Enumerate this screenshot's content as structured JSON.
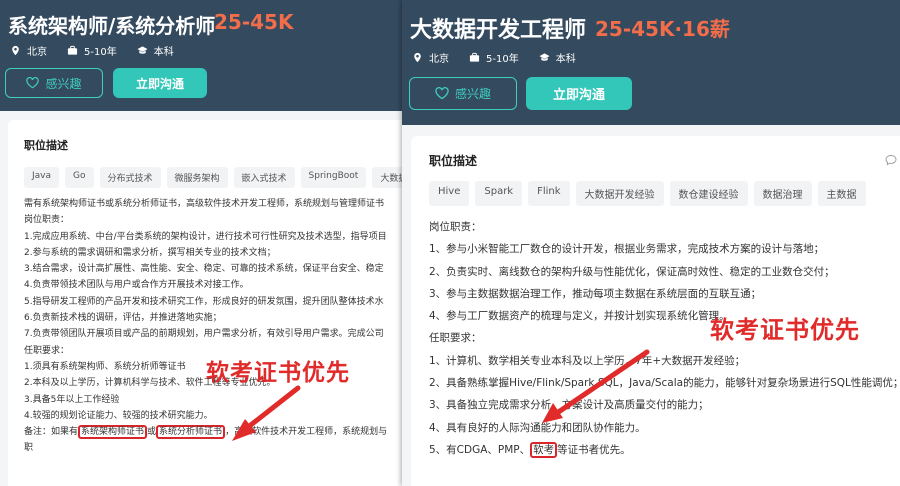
{
  "left": {
    "title": "系统架构师/系统分析师",
    "salary": "25-45K",
    "meta": [
      "北京",
      "5-10年",
      "本科"
    ],
    "buttons": {
      "interest": "感兴趣",
      "chat": "立即沟通"
    },
    "section_title": "职位描述",
    "tags": [
      "Java",
      "Go",
      "分布式技术",
      "微服务架构",
      "嵌入式技术",
      "SpringBoot",
      "大数据架"
    ],
    "lines": [
      "需有系统架构师证书或系统分析师证书，高级软件技术开发工程师，系统规划与管理师证书",
      "岗位职责：",
      "1.完成应用系统、中台/平台类系统的架构设计，进行技术可行性研究及技术选型，指导项目",
      "2.参与系统的需求调研和需求分析，撰写相关专业的技术文档；",
      "3.结合需求，设计高扩展性、高性能、安全、稳定、可靠的技术系统，保证平台安全、稳定",
      "4.负责带领技术团队与用户或合作方开展技术对接工作。",
      "5.指导研发工程师的产品开发和技术研究工作，形成良好的研发氛围，提升团队整体技术水",
      "6.负责新技术栈的调研，评估，并推进落地实施；",
      "7.负责带领团队开展项目或产品的前期规划，用户需求分析，有效引导用户需求。完成公司",
      "任职要求：",
      "1.须具有系统架构师、系统分析师等证书",
      "2.本科及以上学历，计算机科学与技术、软件工程等专业优先。",
      "3.具备5年以上工作经验",
      "4.较强的规划论证能力、较强的技术研究能力。"
    ],
    "note": {
      "prefix": "备注：如果有",
      "hl1": "系统架构师证书",
      "mid": "或",
      "hl2": "系统分析师证书",
      "suffix": "，高级软件技术开发工程师，系统规划与"
    },
    "last_line": "职",
    "annotation": "软考证书优先"
  },
  "right": {
    "title": "大数据开发工程师",
    "salary": "25-45K·16薪",
    "meta": [
      "北京",
      "5-10年",
      "本科"
    ],
    "buttons": {
      "interest": "感兴趣",
      "chat": "立即沟通"
    },
    "section_title": "职位描述",
    "tags": [
      "Hive",
      "Spark",
      "Flink",
      "大数据开发经验",
      "数仓建设经验",
      "数据治理",
      "主数据"
    ],
    "lines": [
      "岗位职责：",
      "1、参与小米智能工厂数仓的设计开发，根据业务需求，完成技术方案的设计与落地；",
      "2、负责实时、离线数仓的架构升级与性能优化，保证高时效性、稳定的工业数仓交付；",
      "3、参与主数据数据治理工作，推动每项主数据在系统层面的互联互通；",
      "4、参与工厂数据资产的梳理与定义，并按计划实现系统化管理。",
      "任职要求：",
      "1、计算机、数学相关专业本科及以上学历，7年+大数据开发经验；",
      "2、具备熟练掌握Hive/Flink/Spark SQL，Java/Scala的能力，能够针对复杂场景进行SQL性能调优；",
      "3、具备独立完成需求分析、方案设计及高质量交付的能力；",
      "4、具有良好的人际沟通能力和团队协作能力。"
    ],
    "last": {
      "prefix": "5、有CDGA、PMP、",
      "hl": "软考",
      "suffix": "等证书者优先。"
    },
    "annotation": "软考证书优先"
  },
  "colors": {
    "header": "#344a5f",
    "accent": "#32c7b8",
    "salary": "#f26d4a",
    "annotation": "#e12a2a"
  },
  "icons": [
    "location-icon",
    "briefcase-icon",
    "graduation-cap-icon",
    "heart-icon",
    "comment-icon"
  ]
}
